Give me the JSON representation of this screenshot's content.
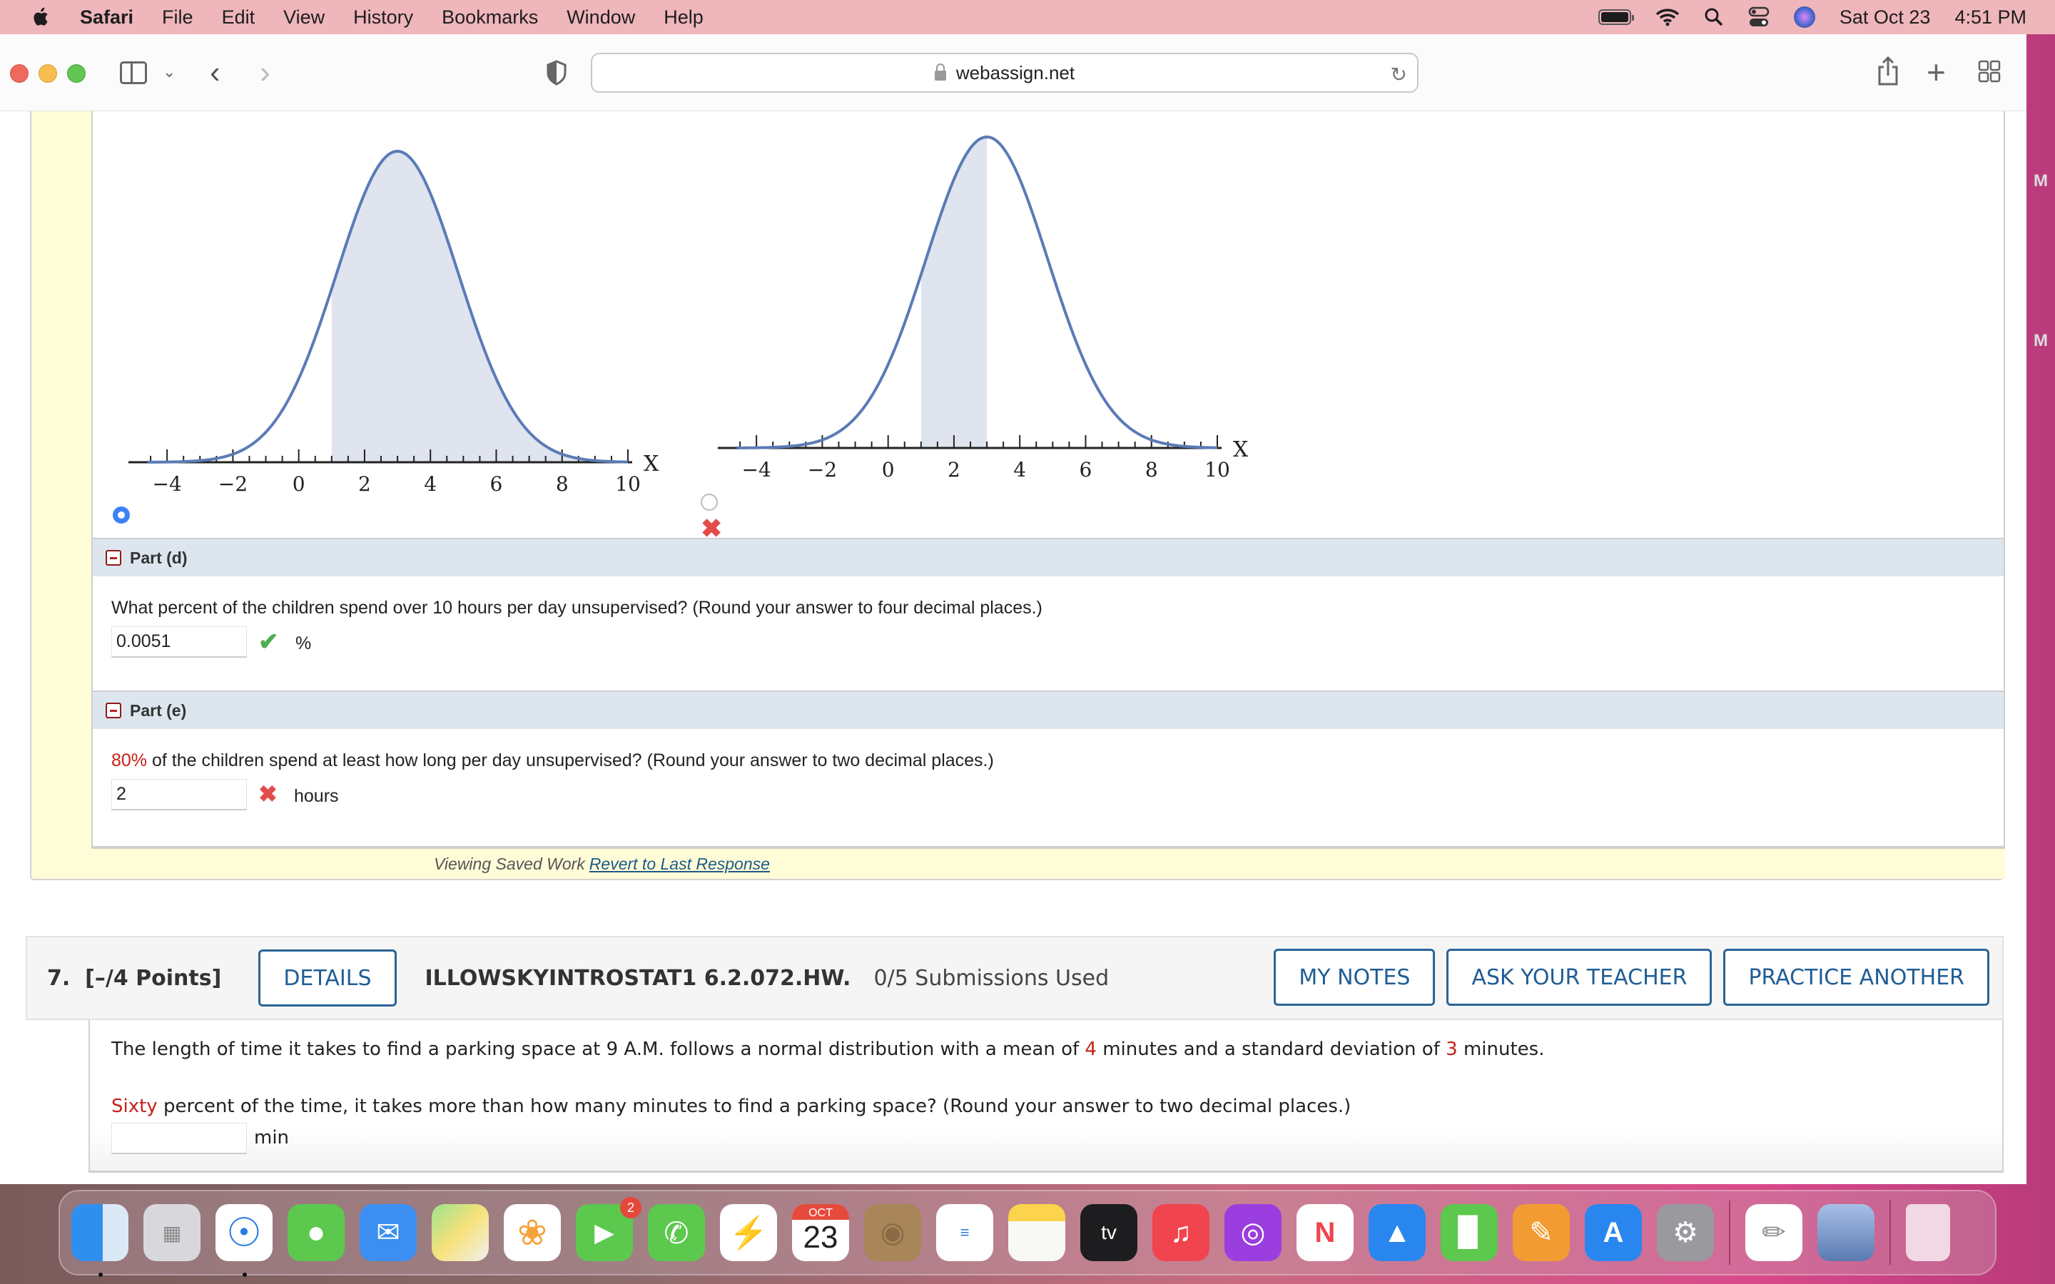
{
  "menubar": {
    "app_name": "Safari",
    "items": [
      "File",
      "Edit",
      "View",
      "History",
      "Bookmarks",
      "Window",
      "Help"
    ],
    "date": "Sat Oct 23",
    "time": "4:51 PM"
  },
  "browser": {
    "url": "webassign.net"
  },
  "question6": {
    "graph_options": [
      {
        "selected": true,
        "status": ""
      },
      {
        "selected": false,
        "status": "incorrect"
      }
    ],
    "part_d": {
      "label": "Part (d)",
      "question": "What percent of the children spend over 10 hours per day unsupervised? (Round your answer to four decimal places.)",
      "answer": "0.0051",
      "status": "correct",
      "unit": "%"
    },
    "part_e": {
      "label": "Part (e)",
      "question_highlight": "80%",
      "question": " of the children spend at least how long per day unsupervised? (Round your answer to two decimal places.)",
      "answer": "2",
      "status": "incorrect",
      "unit": "hours"
    },
    "saved_work": {
      "label": "Viewing Saved Work",
      "link": "Revert to Last Response"
    }
  },
  "question7": {
    "number": "7.",
    "points": "[–/4 Points]",
    "details_label": "DETAILS",
    "code": "ILLOWSKYINTROSTAT1 6.2.072.HW.",
    "submissions": "0/5 Submissions Used",
    "buttons": [
      "MY NOTES",
      "ASK YOUR TEACHER",
      "PRACTICE ANOTHER"
    ],
    "text_1a": "The length of time it takes to find a parking space at 9 A.M. follows a normal distribution with a mean of ",
    "mean": "4",
    "text_1b": " minutes and a standard deviation of ",
    "sd": "3",
    "text_1c": " minutes.",
    "text_2_highlight": "Sixty",
    "text_2": " percent of the time, it takes more than how many minutes to find a parking space? (Round your answer to two decimal places.)",
    "answer": "",
    "unit": "min"
  },
  "dock": {
    "apps": [
      "Finder",
      "Launchpad",
      "Safari",
      "Messages",
      "Mail",
      "Maps",
      "Photos",
      "FaceTime",
      "WhatsApp",
      "Messenger",
      "Calendar",
      "Contacts",
      "Reminders",
      "Notes",
      "Apple TV",
      "Music",
      "Podcasts",
      "News",
      "Keynote",
      "Numbers",
      "Pages",
      "App Store",
      "System Preferences",
      "TextEdit",
      "Preview",
      "Trash"
    ],
    "facetime_badge": "2",
    "calendar_month": "OCT",
    "calendar_day": "23"
  },
  "chart_data": [
    {
      "type": "area",
      "title": "",
      "xlabel": "X",
      "xlim": [
        -5,
        10
      ],
      "xticks": [
        -4,
        -2,
        0,
        2,
        4,
        6,
        8,
        10
      ],
      "distribution": {
        "kind": "normal",
        "mean": 3,
        "sd": 1.85
      },
      "shaded_from": 1,
      "shaded_to": 10,
      "selected": true
    },
    {
      "type": "area",
      "title": "",
      "xlabel": "X",
      "xlim": [
        -5,
        10
      ],
      "xticks": [
        -4,
        -2,
        0,
        2,
        4,
        6,
        8,
        10
      ],
      "distribution": {
        "kind": "normal",
        "mean": 3,
        "sd": 1.85
      },
      "shaded_from": 1,
      "shaded_to": 3,
      "selected": false
    }
  ]
}
